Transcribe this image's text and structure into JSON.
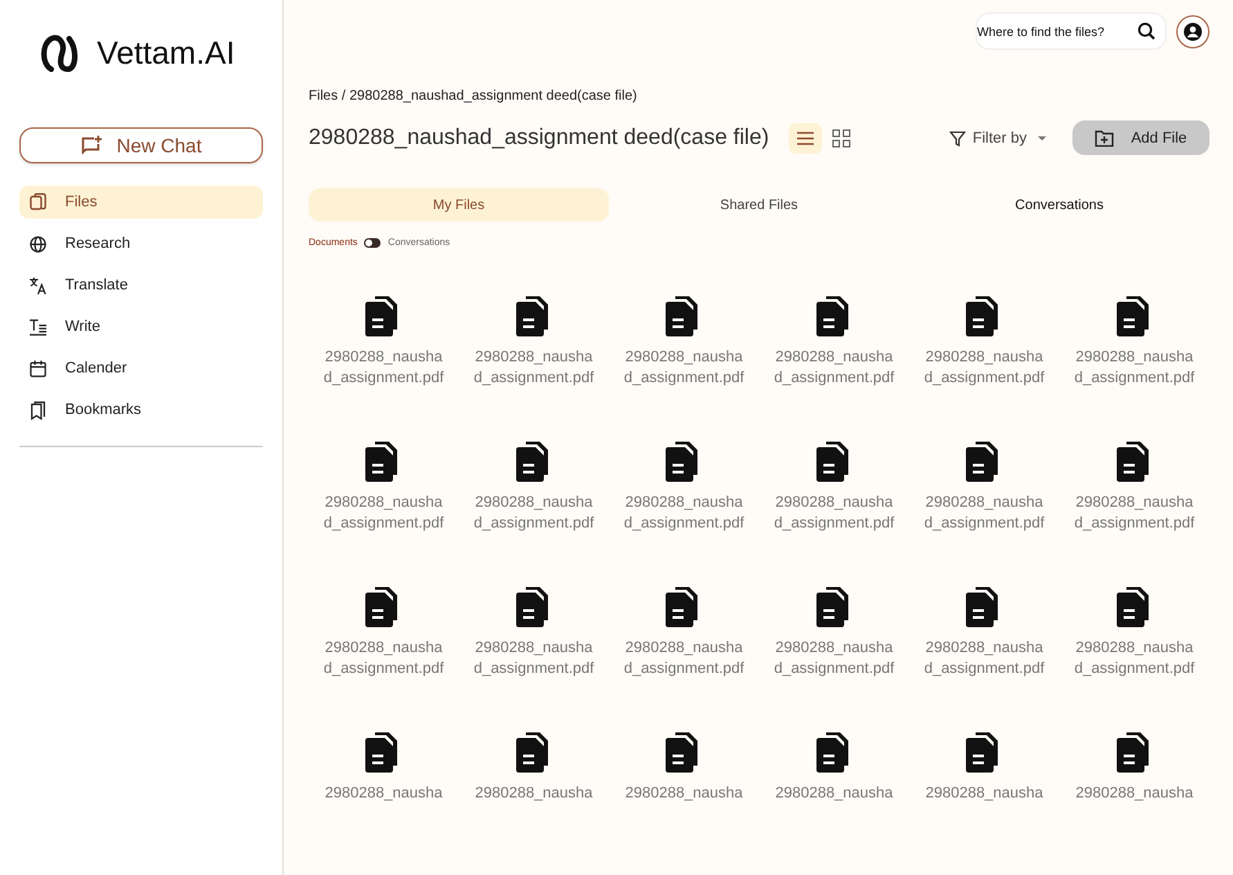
{
  "brand": {
    "name": "Vettam.AI"
  },
  "new_chat": {
    "label": "New Chat"
  },
  "nav": [
    {
      "kind": "files",
      "label": "Files",
      "selected": true
    },
    {
      "kind": "research",
      "label": "Research",
      "selected": false
    },
    {
      "kind": "translate",
      "label": "Translate",
      "selected": false
    },
    {
      "kind": "write",
      "label": "Write",
      "selected": false
    },
    {
      "kind": "calendar",
      "label": "Calender",
      "selected": false
    },
    {
      "kind": "bookmarks",
      "label": "Bookmarks",
      "selected": false
    }
  ],
  "search": {
    "placeholder": "Where to find the files?"
  },
  "breadcrumb": "Files / 2980288_naushad_assignment deed(case file)",
  "title": "2980288_naushad_assignment deed(case file)",
  "view_modes": [
    {
      "kind": "list",
      "selected": true
    },
    {
      "kind": "grid",
      "selected": false
    }
  ],
  "filter": {
    "label": "Filter by"
  },
  "add_file": {
    "label": "Add File"
  },
  "tabs": [
    {
      "label": "My Files",
      "selected": true
    },
    {
      "label": "Shared Files",
      "selected": false
    },
    {
      "label": "Conversations",
      "selected": false
    }
  ],
  "toggle": {
    "left": "Documents",
    "right": "Conversations",
    "on": false
  },
  "files": [
    {
      "name": "2980288_naushad_assignment.pdf"
    },
    {
      "name": "2980288_naushad_assignment.pdf"
    },
    {
      "name": "2980288_naushad_assignment.pdf"
    },
    {
      "name": "2980288_naushad_assignment.pdf"
    },
    {
      "name": "2980288_naushad_assignment.pdf"
    },
    {
      "name": "2980288_naushad_assignment.pdf"
    },
    {
      "name": "2980288_naushad_assignment.pdf"
    },
    {
      "name": "2980288_naushad_assignment.pdf"
    },
    {
      "name": "2980288_naushad_assignment.pdf"
    },
    {
      "name": "2980288_naushad_assignment.pdf"
    },
    {
      "name": "2980288_naushad_assignment.pdf"
    },
    {
      "name": "2980288_naushad_assignment.pdf"
    },
    {
      "name": "2980288_naushad_assignment.pdf"
    },
    {
      "name": "2980288_naushad_assignment.pdf"
    },
    {
      "name": "2980288_naushad_assignment.pdf"
    },
    {
      "name": "2980288_naushad_assignment.pdf"
    },
    {
      "name": "2980288_naushad_assignment.pdf"
    },
    {
      "name": "2980288_naushad_assignment.pdf"
    },
    {
      "name": "2980288_nausha"
    },
    {
      "name": "2980288_nausha"
    },
    {
      "name": "2980288_nausha"
    },
    {
      "name": "2980288_nausha"
    },
    {
      "name": "2980288_nausha"
    },
    {
      "name": "2980288_nausha"
    }
  ]
}
